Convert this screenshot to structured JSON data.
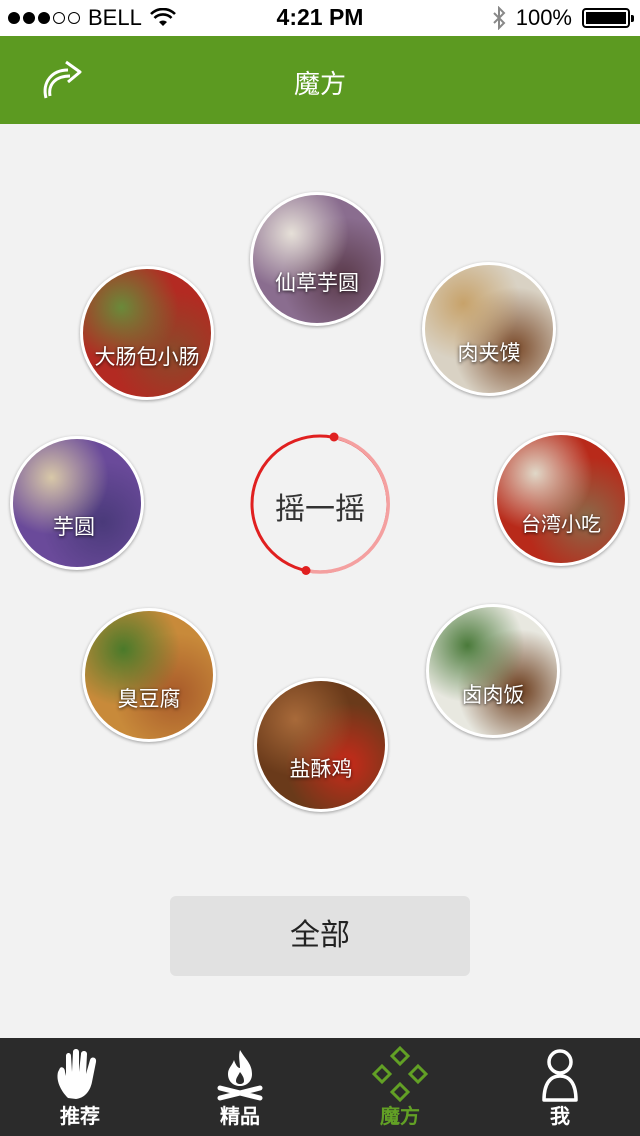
{
  "status_bar": {
    "carrier": "BELL",
    "time": "4:21 PM",
    "battery": "100%",
    "signal_bars_filled": 3,
    "signal_bars_total": 5
  },
  "header": {
    "title": "魔方",
    "back_icon": "curved-arrow-icon",
    "color": "#5c9a21"
  },
  "foods": [
    {
      "label": "仙草芋圆",
      "colors": [
        "#8a6d8f",
        "#e6e0d8",
        "#5a3a4a"
      ]
    },
    {
      "label": "大肠包小肠",
      "colors": [
        "#b32a22",
        "#6a8a3a",
        "#8a4a2a"
      ]
    },
    {
      "label": "肉夹馍",
      "colors": [
        "#d9d2c4",
        "#c7a26a",
        "#7a4a2a"
      ]
    },
    {
      "label": "芋圆",
      "colors": [
        "#6a4a9a",
        "#d8c8a8",
        "#4a3a7a"
      ]
    },
    {
      "label": "台湾小吃",
      "colors": [
        "#b82a1a",
        "#e0d8c8",
        "#8a6a4a"
      ]
    },
    {
      "label": "臭豆腐",
      "colors": [
        "#c88a3a",
        "#4a7a2a",
        "#a85a2a"
      ]
    },
    {
      "label": "卤肉饭",
      "colors": [
        "#e8e8e0",
        "#4a7a3a",
        "#6a3a1a"
      ]
    },
    {
      "label": "盐酥鸡",
      "colors": [
        "#6a3a1a",
        "#a86a3a",
        "#c82a1a"
      ]
    }
  ],
  "shake": {
    "label": "摇一摇",
    "ring_color": "#e02020"
  },
  "all_button": {
    "label": "全部"
  },
  "tabs": [
    {
      "label": "推荐",
      "icon": "hand-icon",
      "active": false
    },
    {
      "label": "精品",
      "icon": "campfire-icon",
      "active": false
    },
    {
      "label": "魔方",
      "icon": "diamond-cube-icon",
      "active": true
    },
    {
      "label": "我",
      "icon": "person-icon",
      "active": false
    }
  ],
  "accent_color": "#62a025"
}
